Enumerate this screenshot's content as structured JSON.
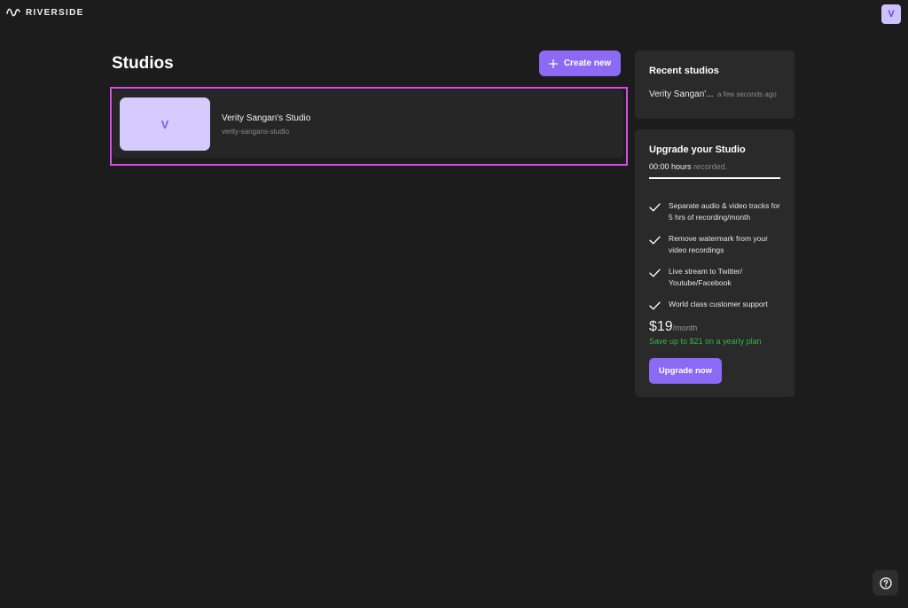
{
  "header": {
    "brand": "RIVERSIDE",
    "logo_icon": "waveform-icon",
    "avatar_initial": "V"
  },
  "main": {
    "title": "Studios",
    "create_label": "Create new",
    "create_icon": "plus-icon",
    "studios": [
      {
        "initial": "V",
        "name": "Verity Sangan's Studio",
        "slug": "verity-sangans-studio"
      }
    ]
  },
  "recent": {
    "title": "Recent studios",
    "items": [
      {
        "name": "Verity Sangan'...",
        "time": "a few seconds ago"
      }
    ]
  },
  "upgrade": {
    "title": "Upgrade your Studio",
    "hours": "00:00 hours",
    "hours_suffix": "recorded.",
    "hours_progress": 1.0,
    "features": [
      "Separate audio & video tracks for 5 hrs of recording/month",
      "Remove watermark from your video recordings",
      "Live stream to Twitter/ Youtube/Facebook",
      "World class customer support"
    ],
    "price": "$19",
    "period": "/month",
    "save_text": "Save up to $21 on a yearly plan",
    "button": "Upgrade now"
  },
  "help_icon": "question-circle-icon",
  "colors": {
    "accent": "#8b6bf5",
    "background": "#1c1c1c",
    "panel": "#2a2a2a",
    "selection": "#d64ce0",
    "success": "#37b24d"
  }
}
